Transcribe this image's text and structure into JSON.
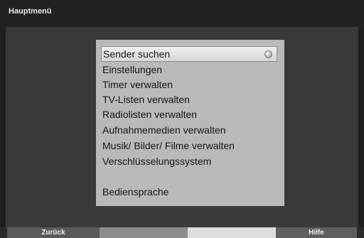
{
  "window": {
    "title": "Hauptmenü"
  },
  "menu": {
    "items": [
      {
        "label": "Sender suchen",
        "selected": true
      },
      {
        "label": "Einstellungen"
      },
      {
        "label": "Timer verwalten"
      },
      {
        "label": "TV-Listen verwalten"
      },
      {
        "label": "Radiolisten verwalten"
      },
      {
        "label": "Aufnahmemedien verwalten"
      },
      {
        "label": "Musik/ Bilder/ Filme verwalten"
      },
      {
        "label": "Verschlüsselungssystem"
      },
      {
        "label": "Bediensprache"
      }
    ]
  },
  "footer": {
    "red_label": "Zurück",
    "green_label": "",
    "yellow_label": "",
    "blue_label": "Hilfe"
  },
  "icons": {
    "selection_indicator": "radio-bullet-icon"
  }
}
